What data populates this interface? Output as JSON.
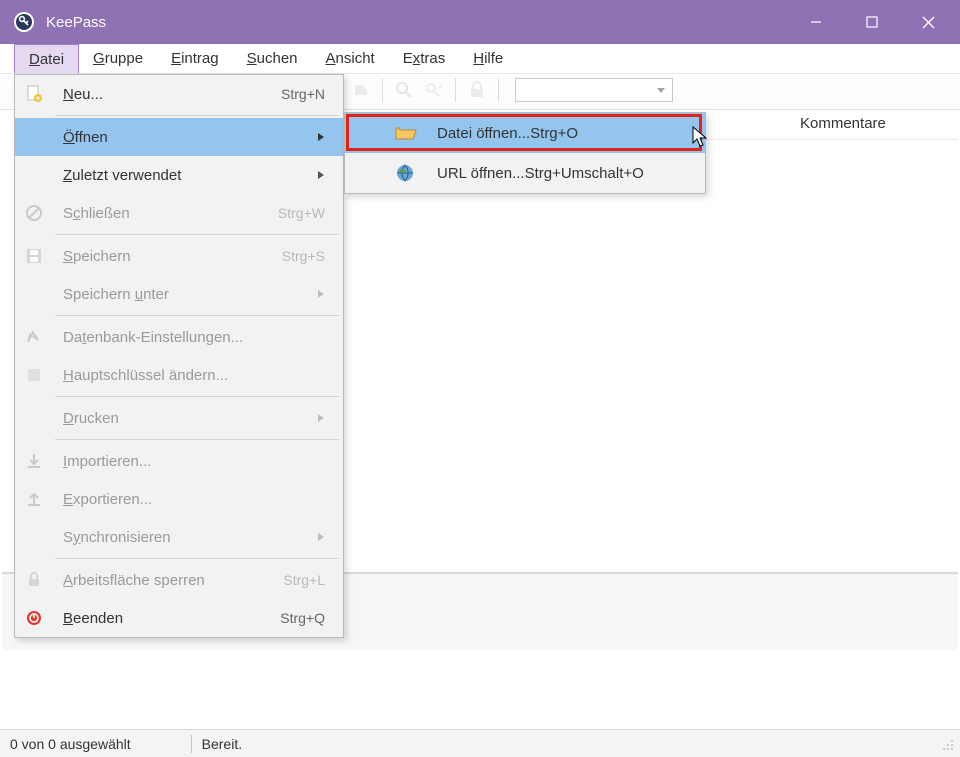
{
  "title": "KeePass",
  "menubar": [
    "Datei",
    "Gruppe",
    "Eintrag",
    "Suchen",
    "Ansicht",
    "Extras",
    "Hilfe"
  ],
  "columns": {
    "kommentare": "Kommentare"
  },
  "status": {
    "selection": "0 von 0 ausgewählt",
    "ready": "Bereit."
  },
  "menu": {
    "new": {
      "label": "Neu...",
      "shortcut": "Strg+N"
    },
    "open": {
      "label": "Öffnen"
    },
    "recent": {
      "label": "Zuletzt verwendet"
    },
    "close": {
      "label": "Schließen",
      "shortcut": "Strg+W"
    },
    "save": {
      "label": "Speichern",
      "shortcut": "Strg+S"
    },
    "saveas": {
      "label": "Speichern unter"
    },
    "dbsettings": {
      "label": "Datenbank-Einstellungen..."
    },
    "masterkey": {
      "label": "Hauptschlüssel ändern..."
    },
    "print": {
      "label": "Drucken"
    },
    "import": {
      "label": "Importieren..."
    },
    "export": {
      "label": "Exportieren..."
    },
    "sync": {
      "label": "Synchronisieren"
    },
    "lock": {
      "label": "Arbeitsfläche sperren",
      "shortcut": "Strg+L"
    },
    "quit": {
      "label": "Beenden",
      "shortcut": "Strg+Q"
    }
  },
  "submenu": {
    "openfile": {
      "label": "Datei öffnen...",
      "shortcut": "Strg+O"
    },
    "openurl": {
      "label": "URL öffnen...",
      "shortcut": "Strg+Umschalt+O"
    }
  }
}
